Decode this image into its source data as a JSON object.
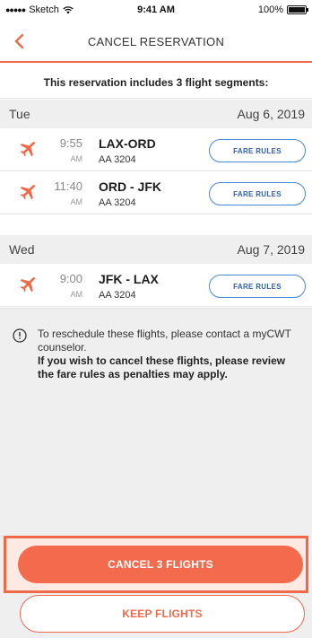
{
  "status_bar": {
    "carrier": "Sketch",
    "time": "9:41 AM",
    "battery": "100%",
    "battery_level": 1.0
  },
  "nav": {
    "title": "CANCEL RESERVATION",
    "back_icon": "chevron-left-icon"
  },
  "banner": "This reservation includes 3 flight segments:",
  "days": [
    {
      "day": "Tue",
      "date": "Aug 6, 2019",
      "flights": [
        {
          "time": "9:55",
          "ampm": "AM",
          "route": "LAX-ORD",
          "number": "AA 3204",
          "button": "FARE RULES"
        },
        {
          "time": "11:40",
          "ampm": "AM",
          "route": "ORD - JFK",
          "number": "AA 3204",
          "button": "FARE RULES"
        }
      ]
    },
    {
      "day": "Wed",
      "date": "Aug 7, 2019",
      "flights": [
        {
          "time": "9:00",
          "ampm": "AM",
          "route": "JFK - LAX",
          "number": "AA 3204",
          "button": "FARE RULES"
        }
      ]
    }
  ],
  "notice": {
    "text": "To reschedule these flights, please contact a myCWT counselor.",
    "bold": "If you wish to cancel these flights, please review the fare rules as penalties may apply."
  },
  "actions": {
    "cancel": "CANCEL 3 FLIGHTS",
    "keep": "KEEP FLIGHTS"
  },
  "colors": {
    "accent": "#f06a4a",
    "link_blue": "#4a86d8",
    "background_gray": "#efefef"
  }
}
